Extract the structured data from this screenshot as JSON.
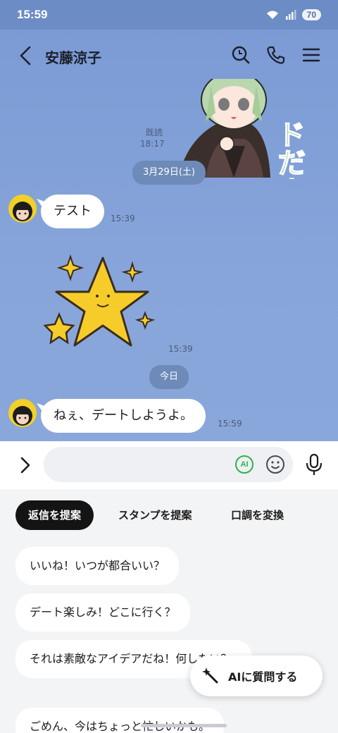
{
  "status_bar": {
    "time": "15:59",
    "battery": "70"
  },
  "header": {
    "title": "安藤涼子"
  },
  "messages": {
    "top_sticker_text": "ドだよ",
    "read_label": "既読",
    "read_time": "18:17",
    "date_1": "3月29日(土)",
    "msg_1": {
      "text": "テスト",
      "time": "15:39"
    },
    "sticker_time": "15:39",
    "date_2": "今日",
    "msg_2": {
      "text": "ねぇ、デートしようよ。",
      "time": "15:59"
    }
  },
  "input": {
    "placeholder": "",
    "ai_badge": "AI"
  },
  "suggest": {
    "tabs": [
      "返信を提案",
      "スタンプを提案",
      "口調を変換"
    ],
    "items": [
      "いいね！いつが都合いい？",
      "デート楽しみ！どこに行く？",
      "それは素敵なアイデアだね！何したい？",
      "ごめん、今はちょっと忙しいかも。"
    ]
  },
  "ai_fab": {
    "label": "AIに質問する"
  },
  "colors": {
    "chat_bg": "#87a5da",
    "accent_green": "#2ab34b"
  }
}
